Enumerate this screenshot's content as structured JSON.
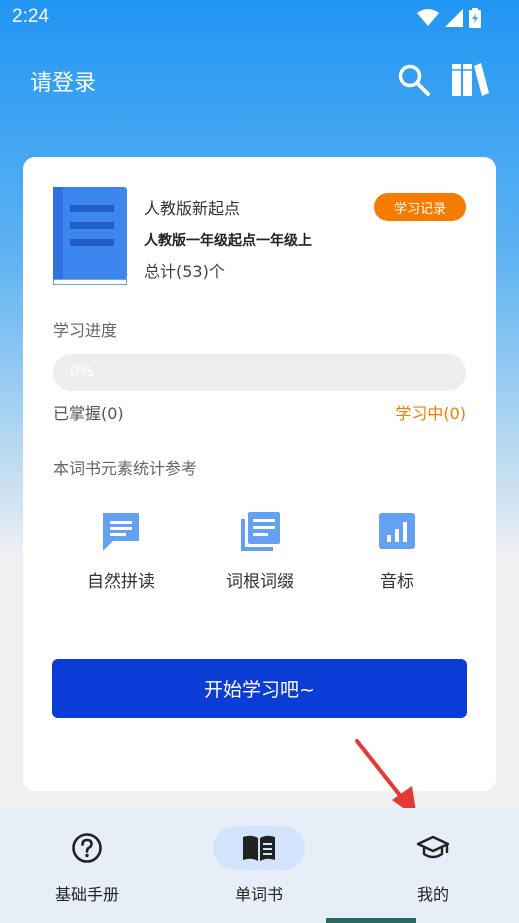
{
  "status_bar": {
    "time": "2:24"
  },
  "app_bar": {
    "title": "请登录"
  },
  "book": {
    "name": "人教版新起点",
    "description": "人教版一年级起点一年级上",
    "count": "总计(53)个",
    "record_button": "学习记录"
  },
  "progress": {
    "section_label": "学习进度",
    "value_text": "0%",
    "fraction": 0,
    "mastered": "已掌握(0)",
    "learning": "学习中(0)"
  },
  "features": {
    "section_label": "本词书元素统计参考",
    "items": [
      {
        "label": "自然拼读",
        "icon": "chat-bubble-icon"
      },
      {
        "label": "词根词缀",
        "icon": "library-list-icon"
      },
      {
        "label": "音标",
        "icon": "bar-chart-icon"
      }
    ]
  },
  "start_button": "开始学习吧~",
  "bottom_nav": [
    {
      "label": "基础手册",
      "icon": "help-circle-icon",
      "active": false
    },
    {
      "label": "单词书",
      "icon": "open-book-icon",
      "active": true
    },
    {
      "label": "我的",
      "icon": "graduation-cap-icon",
      "active": false
    }
  ],
  "colors": {
    "primary": "#2196f3",
    "accent": "#f57c00",
    "button": "#0c3cd6",
    "annotation_arrow": "#e53935"
  }
}
